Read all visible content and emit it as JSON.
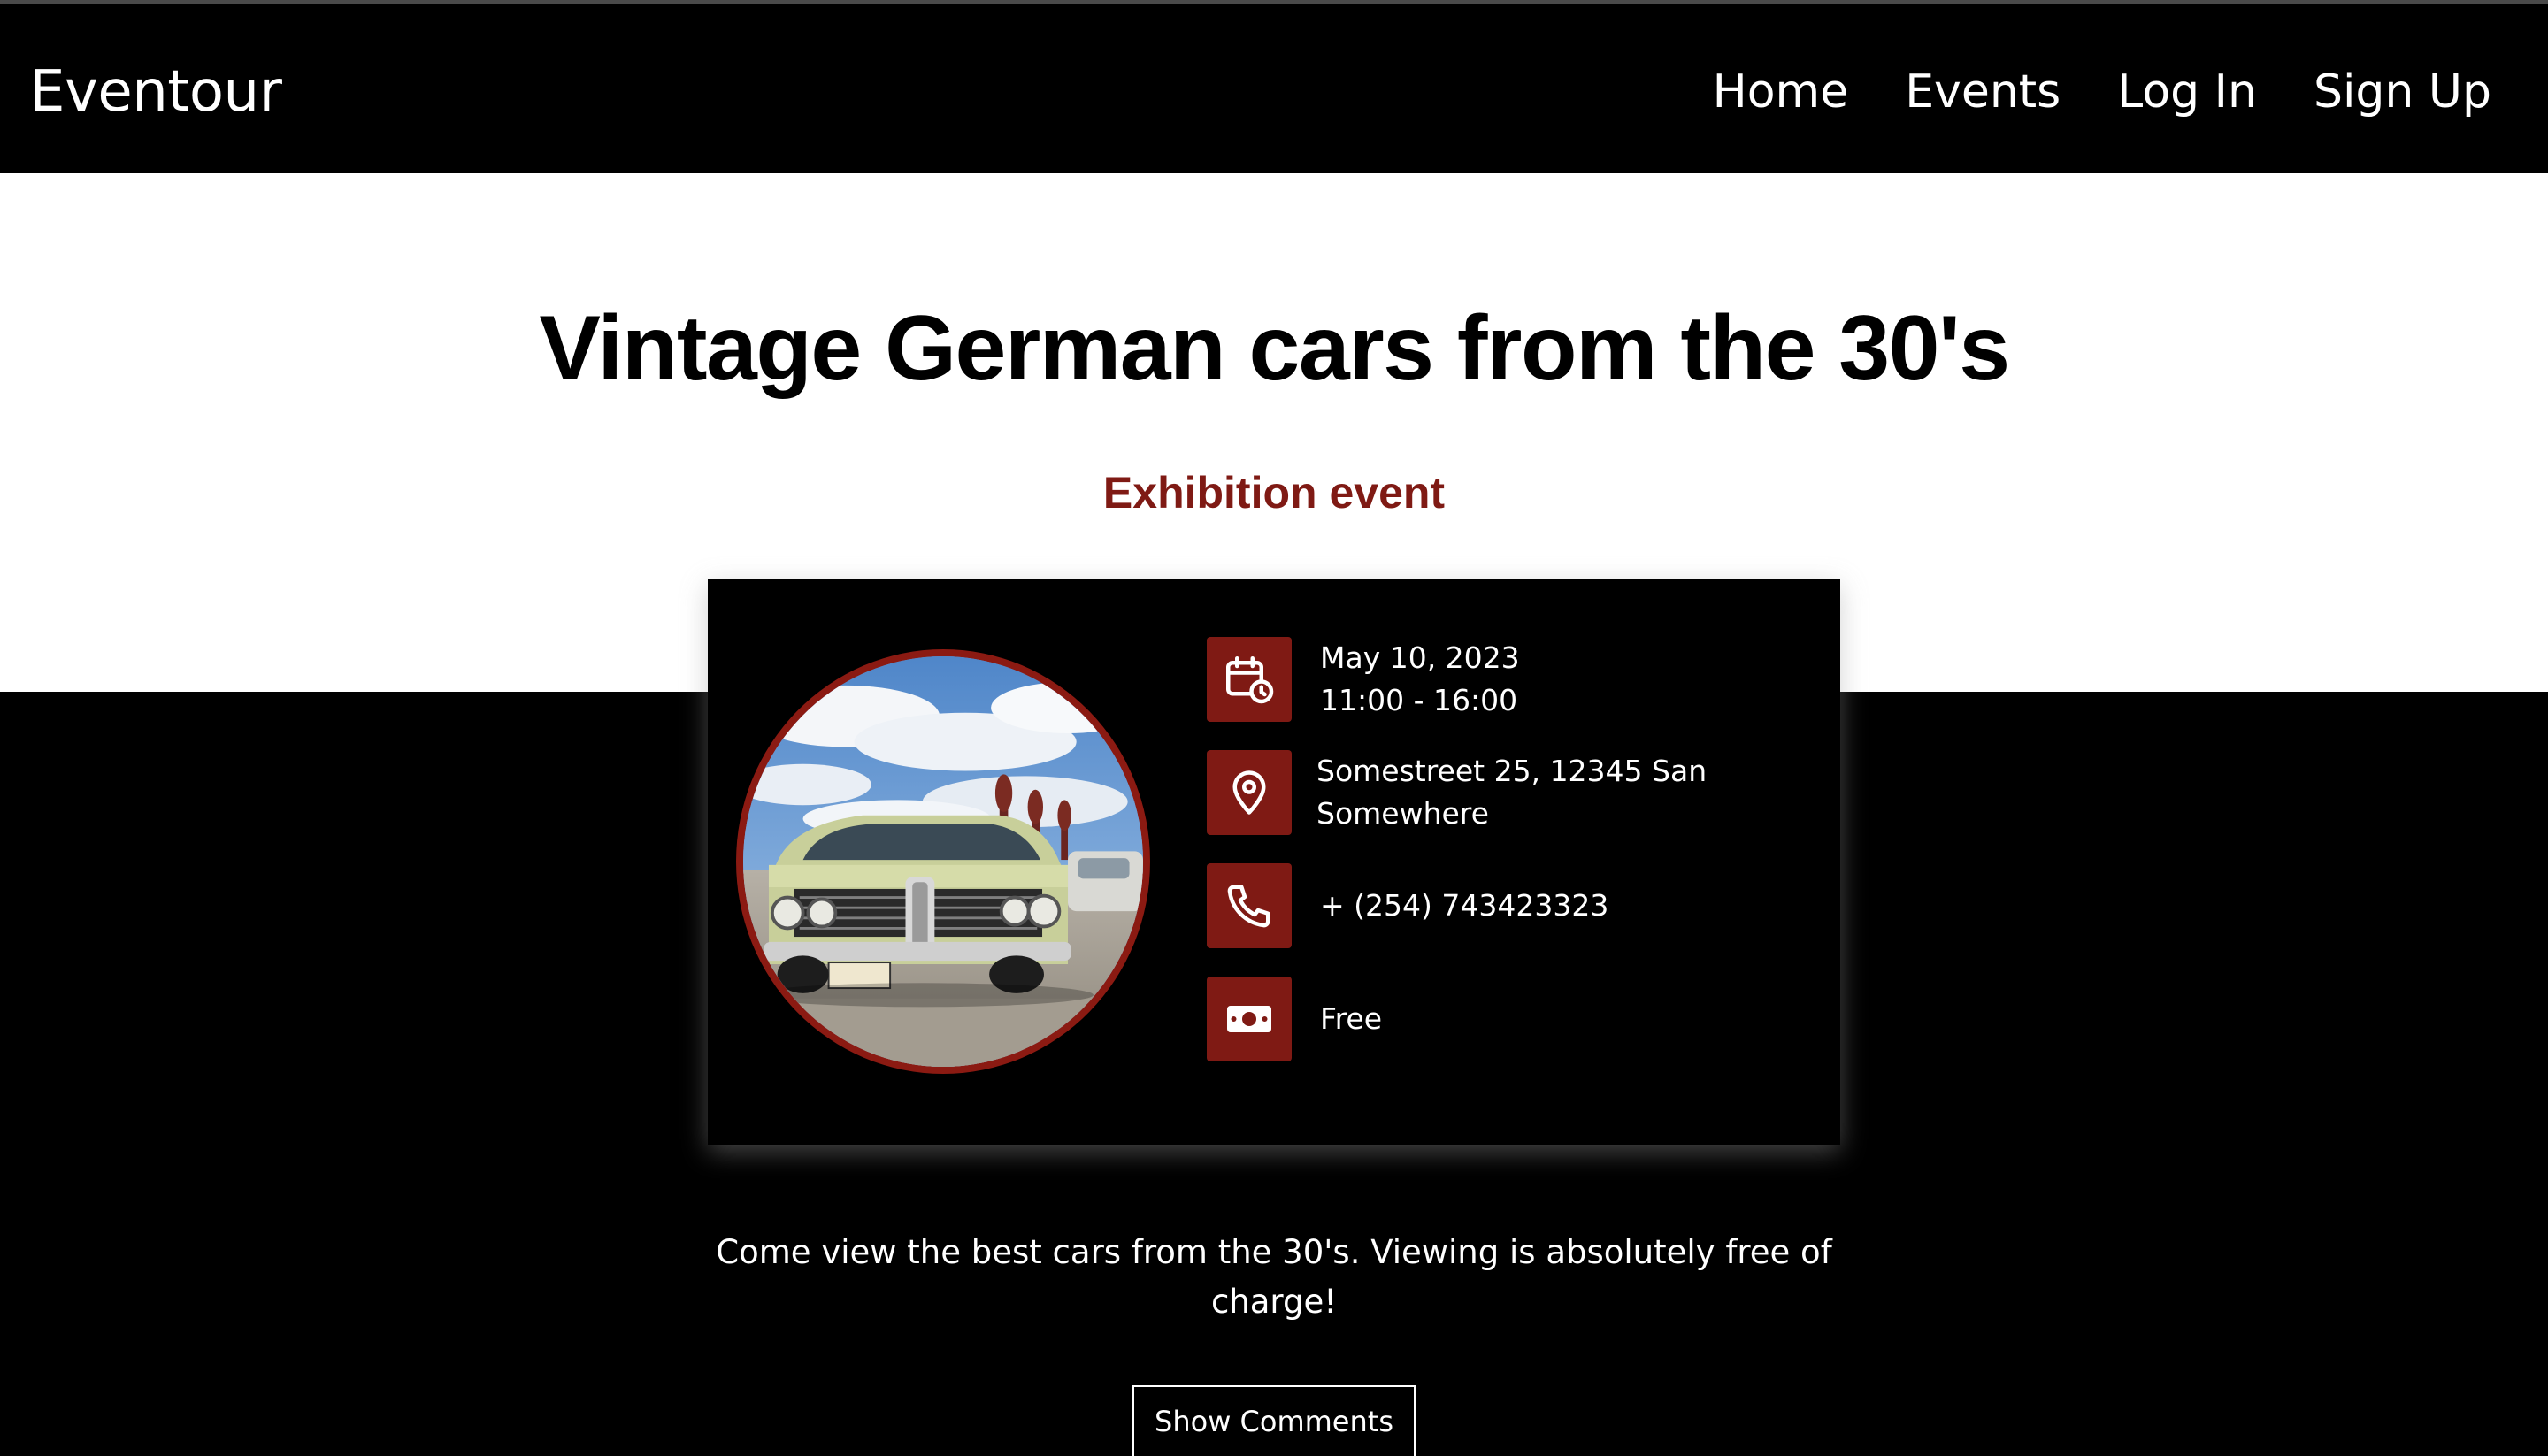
{
  "navbar": {
    "brand": "Eventour",
    "links": [
      {
        "label": "Home"
      },
      {
        "label": "Events"
      },
      {
        "label": "Log In"
      },
      {
        "label": "Sign Up"
      }
    ]
  },
  "event": {
    "title": "Vintage German cars from the 30's",
    "category": "Exhibition event",
    "date": "May 10, 2023",
    "time": "11:00 - 16:00",
    "address": "Somestreet 25, 12345 San Somewhere",
    "phone": "+ (254) 743423323",
    "price": "Free",
    "description": "Come view the best cars from the 30's. Viewing is absolutely free of charge!"
  },
  "icons": {
    "date": "calendar-clock-icon",
    "location": "map-pin-icon",
    "phone": "phone-icon",
    "price": "money-bill-icon"
  },
  "buttons": {
    "show_comments": "Show Comments"
  },
  "colors": {
    "accent": "#7f1a14",
    "background": "#000000",
    "hero_background": "#ffffff"
  }
}
